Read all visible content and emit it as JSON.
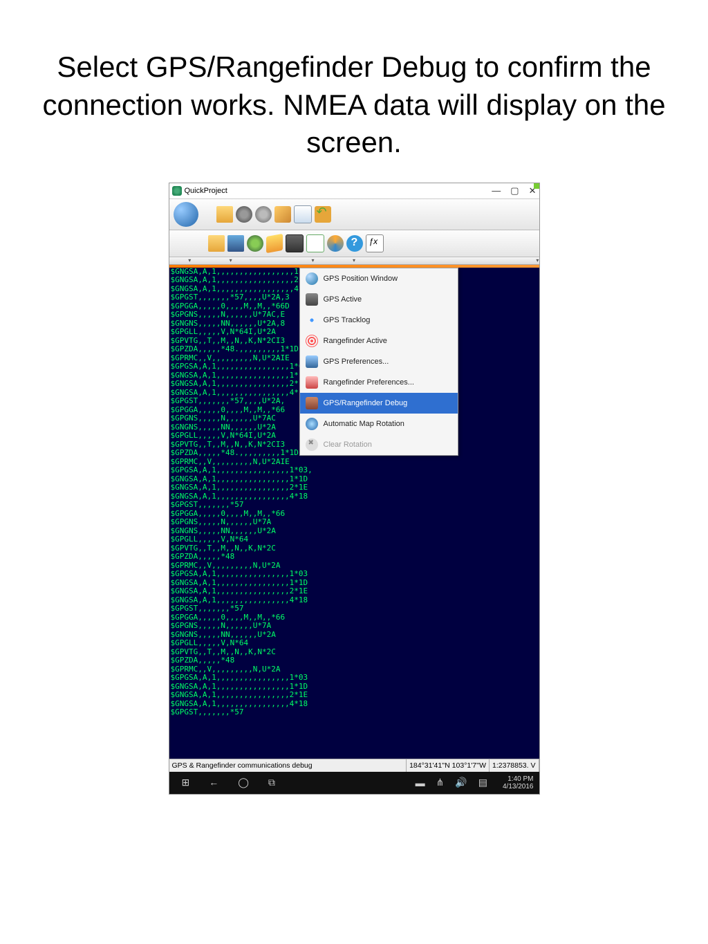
{
  "slide": {
    "title": "Select GPS/Rangefinder Debug to confirm the connection works. NMEA data will display on the screen."
  },
  "window": {
    "title": "QuickProject",
    "minimize": "—",
    "maximize": "▢",
    "close": "✕"
  },
  "menu": {
    "items": [
      {
        "label": "GPS Position Window",
        "icon": "mi-globe"
      },
      {
        "label": "GPS Active",
        "icon": "mi-sat"
      },
      {
        "label": "GPS Tracklog",
        "icon": "mi-dots"
      },
      {
        "label": "Rangefinder Active",
        "icon": "mi-waves"
      },
      {
        "label": "GPS Preferences...",
        "icon": "mi-pref"
      },
      {
        "label": "Rangefinder Preferences...",
        "icon": "mi-rpref"
      },
      {
        "label": "GPS/Rangefinder Debug",
        "icon": "mi-debug",
        "highlighted": true
      },
      {
        "label": "Automatic Map Rotation",
        "icon": "mi-rotate"
      },
      {
        "label": "Clear Rotation",
        "icon": "mi-clear",
        "disabled": true
      }
    ]
  },
  "nmea": [
    "$GNGSA,A,1,,,,,,,,,,,,,,,,,1*1D",
    "$GNGSA,A,1,,,,,,,,,,,,,,,,,2*1E",
    "$GNGSA,A,1,,,,,,,,,,,,,,,,,4*18",
    "$GPGST,,,,,,,*57,,,,U*2A,3",
    "$GPGGA,,,,,0,,,,M,,M,,*66D",
    "$GPGNS,,,,,N,,,,,,U*7AC,E",
    "$GNGNS,,,,,NN,,,,,,U*2A,8",
    "$GPGLL,,,,,V,N*64I,U*2A",
    "$GPVTG,,T,,M,,N,,K,N*2CI3",
    "$GPZDA,,,,,*48.,,,,,,,,,1*1D",
    "$GPRMC,,V,,,,,,,,,N,U*2AIE",
    "$GPGSA,A,1,,,,,,,,,,,,,,,,1*03,",
    "$GNGSA,A,1,,,,,,,,,,,,,,,,1*1D",
    "$GNGSA,A,1,,,,,,,,,,,,,,,,2*1E",
    "$GNGSA,A,1,,,,,,,,,,,,,,,,4*18",
    "$GPGST,,,,,,,*57,,,,U*2A,",
    "$GPGGA,,,,,0,,,,M,,M,,*66",
    "$GPGNS,,,,,N,,,,,,U*7AC",
    "$GNGNS,,,,,NN,,,,,,U*2A",
    "$GPGLL,,,,,V,N*64I,U*2A",
    "$GPVTG,,T,,M,,N,,K,N*2CI3",
    "$GPZDA,,,,,*48.,,,,,,,,,1*1D",
    "$GPRMC,,V,,,,,,,,,N,U*2AIE",
    "$GPGSA,A,1,,,,,,,,,,,,,,,,1*03,",
    "$GNGSA,A,1,,,,,,,,,,,,,,,,1*1D",
    "$GNGSA,A,1,,,,,,,,,,,,,,,,2*1E",
    "$GNGSA,A,1,,,,,,,,,,,,,,,,4*18",
    "$GPGST,,,,,,,*57",
    "$GPGGA,,,,,0,,,,M,,M,,*66",
    "$GPGNS,,,,,N,,,,,,U*7A",
    "$GNGNS,,,,,NN,,,,,,U*2A",
    "$GPGLL,,,,,V,N*64",
    "$GPVTG,,T,,M,,N,,K,N*2C",
    "$GPZDA,,,,,*48",
    "$GPRMC,,V,,,,,,,,,N,U*2A",
    "$GPGSA,A,1,,,,,,,,,,,,,,,,1*03",
    "$GNGSA,A,1,,,,,,,,,,,,,,,,1*1D",
    "$GNGSA,A,1,,,,,,,,,,,,,,,,2*1E",
    "$GNGSA,A,1,,,,,,,,,,,,,,,,4*18",
    "$GPGST,,,,,,,*57",
    "$GPGGA,,,,,0,,,,M,,M,,*66",
    "$GPGNS,,,,,N,,,,,,U*7A",
    "$GNGNS,,,,,NN,,,,,,U*2A",
    "$GPGLL,,,,,V,N*64",
    "$GPVTG,,T,,M,,N,,K,N*2C",
    "$GPZDA,,,,,*48",
    "$GPRMC,,V,,,,,,,,,N,U*2A",
    "$GPGSA,A,1,,,,,,,,,,,,,,,,1*03",
    "$GNGSA,A,1,,,,,,,,,,,,,,,,1*1D",
    "$GNGSA,A,1,,,,,,,,,,,,,,,,2*1E",
    "$GNGSA,A,1,,,,,,,,,,,,,,,,4*18",
    "$GPGST,,,,,,,*57"
  ],
  "status": {
    "left": "GPS & Rangefinder communications debug",
    "coords": "184°31'41''N 103°1'7''W",
    "scale": "1:2378853. V"
  },
  "taskbar": {
    "time": "1:40 PM",
    "date": "4/13/2016"
  }
}
